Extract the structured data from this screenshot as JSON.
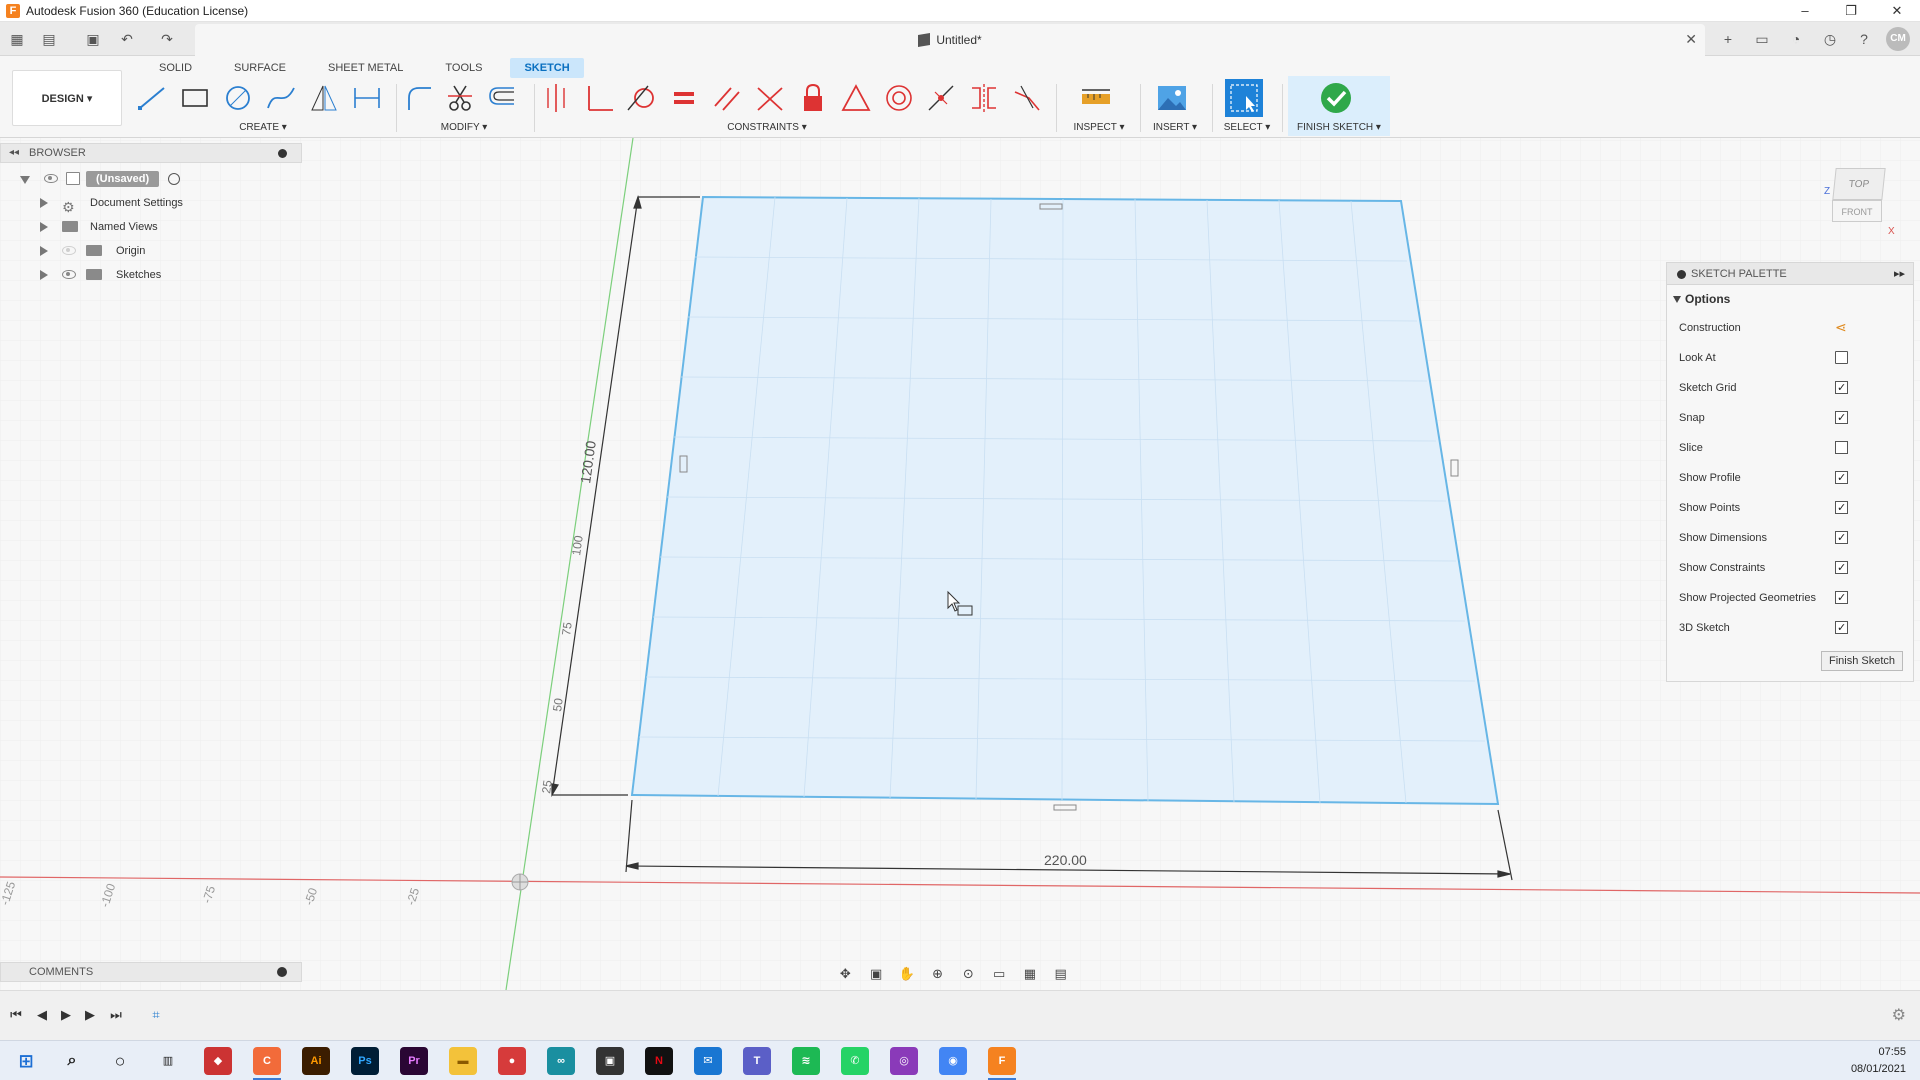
{
  "window": {
    "title": "Autodesk Fusion 360 (Education License)",
    "controls": [
      "–",
      "❐",
      "✕"
    ]
  },
  "document": {
    "title": "Untitled*",
    "close": "✕"
  },
  "header": {
    "avatar": "CM"
  },
  "ribbon": {
    "workspace": "DESIGN ▾",
    "tabs": [
      "SOLID",
      "SURFACE",
      "SHEET METAL",
      "TOOLS",
      "SKETCH"
    ],
    "active_tab": "SKETCH",
    "groups": {
      "create": "CREATE ▾",
      "modify": "MODIFY ▾",
      "constraints": "CONSTRAINTS ▾",
      "inspect": "INSPECT ▾",
      "insert": "INSERT ▾",
      "select": "SELECT ▾",
      "finish": "FINISH SKETCH ▾"
    }
  },
  "browser": {
    "title": "BROWSER",
    "root": "(Unsaved)",
    "items": [
      {
        "label": "Document Settings",
        "icon": "gear-icon"
      },
      {
        "label": "Named Views",
        "icon": "folder-icon"
      },
      {
        "label": "Origin",
        "icon": "folder-icon"
      },
      {
        "label": "Sketches",
        "icon": "folder-icon"
      }
    ]
  },
  "viewcube": {
    "top": "TOP",
    "front": "FRONT",
    "z": "Z",
    "x": "X"
  },
  "sketch": {
    "width_dim": "220.00",
    "height_dim": "120.00",
    "vertical_ticks": [
      "25",
      "50",
      "75",
      "100"
    ],
    "axis_ticks": [
      "-125",
      "-100",
      "-75",
      "-50",
      "-25"
    ]
  },
  "palette": {
    "title": "SKETCH PALETTE",
    "section": "Options",
    "options": [
      {
        "label": "Construction",
        "type": "icon"
      },
      {
        "label": "Look At",
        "type": "icon"
      },
      {
        "label": "Sketch Grid",
        "checked": true
      },
      {
        "label": "Snap",
        "checked": true
      },
      {
        "label": "Slice",
        "checked": false
      },
      {
        "label": "Show Profile",
        "checked": true
      },
      {
        "label": "Show Points",
        "checked": true
      },
      {
        "label": "Show Dimensions",
        "checked": true
      },
      {
        "label": "Show Constraints",
        "checked": true
      },
      {
        "label": "Show Projected Geometries",
        "checked": true
      },
      {
        "label": "3D Sketch",
        "checked": true
      }
    ],
    "finish_button": "Finish Sketch"
  },
  "comments": {
    "title": "COMMENTS"
  },
  "taskbar": {
    "time": "07:55",
    "date": "08/01/2021"
  },
  "colors": {
    "accent": "#0a70c0",
    "sketch_fill": "#e3f0fb",
    "sketch_edge": "#67b6e6",
    "x_axis": "#e06666",
    "y_axis": "#7ccf7c"
  }
}
